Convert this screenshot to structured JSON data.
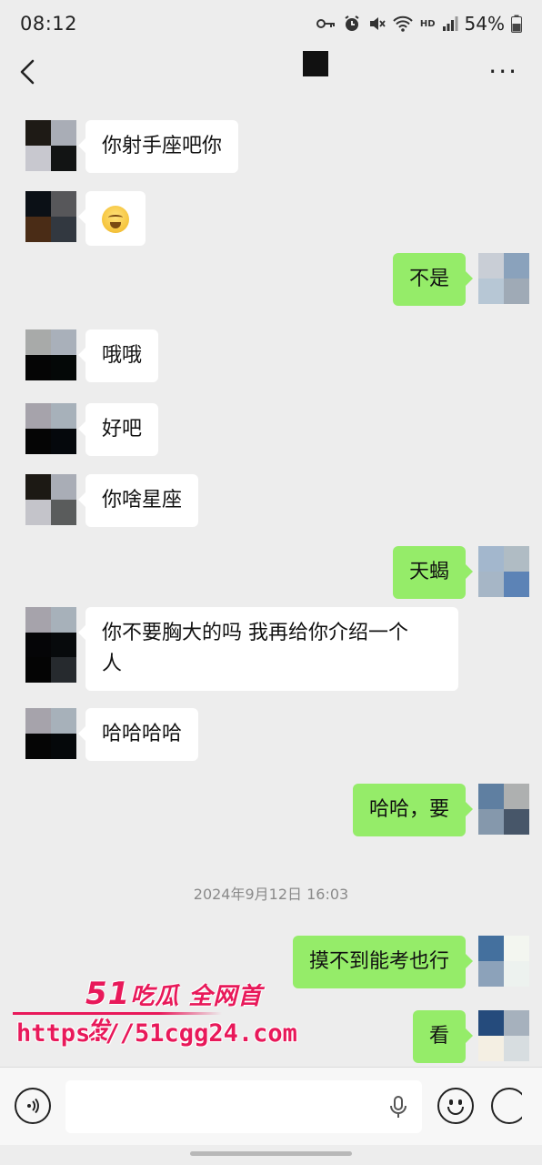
{
  "status_bar": {
    "time": "08:12",
    "battery": "54%"
  },
  "nav": {
    "back_icon": "chevron-left-icon",
    "more_icon": "more-dots-icon"
  },
  "messages": [
    {
      "side": "in",
      "text": "你射手座吧你",
      "avatar": [
        "#1e1a15",
        "#a9adb6",
        "#c8c8cf",
        "#121414"
      ]
    },
    {
      "side": "in",
      "text": "",
      "emoji": "crying-face-emoji",
      "avatar": [
        "#0b1016",
        "#57575a",
        "#4a2c16",
        "#323840"
      ]
    },
    {
      "side": "out",
      "text": "不是",
      "avatar": [
        "#c9ced6",
        "#8aa2bc",
        "#b7c7d5",
        "#9faab6"
      ]
    },
    {
      "side": "in",
      "text": "哦哦",
      "avatar": [
        "#a8aaa9",
        "#a9b0ba",
        "#050505",
        "#040807"
      ]
    },
    {
      "side": "in",
      "text": "好吧",
      "avatar": [
        "#a6a3ab",
        "#a7b1ba",
        "#050505",
        "#05080c"
      ]
    },
    {
      "side": "in",
      "text": "你啥星座",
      "avatar": [
        "#1c1914",
        "#a9adb6",
        "#c4c4ca",
        "#5a5c5c"
      ]
    },
    {
      "side": "out",
      "text": "天蝎",
      "avatar": [
        "#a3b7cd",
        "#b0bcc4",
        "#a6b6c6",
        "#5c83b6"
      ]
    },
    {
      "side": "in",
      "text": "你不要胸大的吗 我再给你介绍一个\n人",
      "avatar": [
        "#a6a3ab",
        "#a7b1ba",
        "#050507",
        "#070a0c",
        "#040404",
        "#262a2e"
      ]
    },
    {
      "side": "in",
      "text": "哈哈哈哈",
      "avatar": [
        "#a6a3ab",
        "#a7b1ba",
        "#050505",
        "#05080a"
      ]
    },
    {
      "side": "out",
      "text": "哈哈，要",
      "avatar": [
        "#5f7fa1",
        "#aeb0b0",
        "#8598ac",
        "#475669"
      ]
    },
    {
      "side": "out",
      "text": "摸不到能考也行",
      "avatar": [
        "#44709e",
        "#f3f6f0",
        "#8ca2ba",
        "#edf2ef"
      ]
    },
    {
      "side": "out",
      "text": "看",
      "avatar": [
        "#254b7c",
        "#a6b1bd",
        "#f4efe3",
        "#d7dde0"
      ]
    }
  ],
  "timestamp": "2024年9月12日 16:03",
  "watermark": {
    "brand_number": "51",
    "brand_text": "吃瓜 全网首发",
    "url": "https://51cgg24.com"
  },
  "input_bar": {
    "voice_icon": "voice-mode-icon",
    "mic_icon": "microphone-icon",
    "emoji_icon": "emoji-icon",
    "plus_icon": "plus-icon"
  }
}
